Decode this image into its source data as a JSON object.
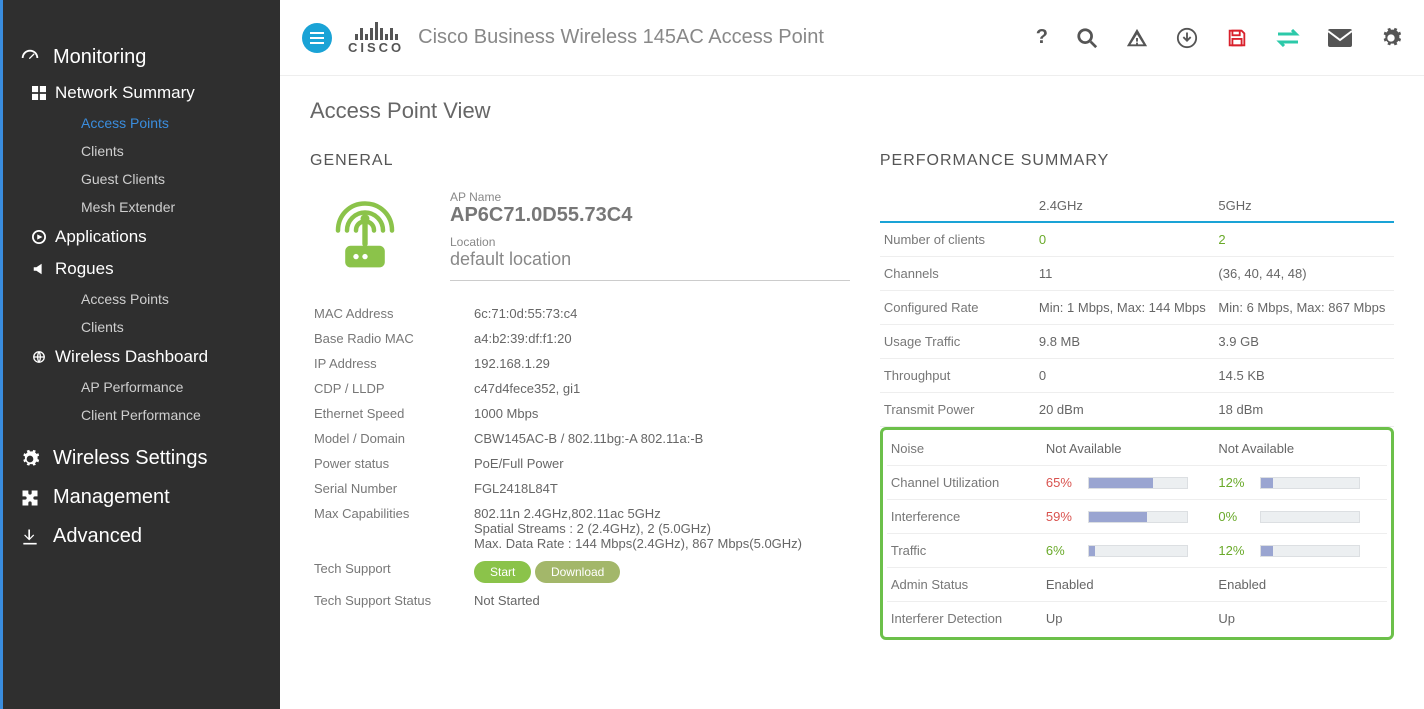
{
  "header": {
    "product_name": "Cisco Business Wireless 145AC Access Point",
    "logo_text": "CISCO"
  },
  "sidebar": {
    "monitoring": "Monitoring",
    "network_summary": "Network Summary",
    "ns_items": [
      "Access Points",
      "Clients",
      "Guest Clients",
      "Mesh Extender"
    ],
    "applications": "Applications",
    "rogues": "Rogues",
    "rogues_items": [
      "Access Points",
      "Clients"
    ],
    "wireless_dashboard": "Wireless Dashboard",
    "wd_items": [
      "AP Performance",
      "Client Performance"
    ],
    "wireless_settings": "Wireless Settings",
    "management": "Management",
    "advanced": "Advanced"
  },
  "page": {
    "title": "Access Point View",
    "general_head": "GENERAL",
    "perf_head": "PERFORMANCE SUMMARY"
  },
  "ap": {
    "name_label": "AP Name",
    "name": "AP6C71.0D55.73C4",
    "location_label": "Location",
    "location": "default location",
    "fields": [
      {
        "k": "MAC Address",
        "v": "6c:71:0d:55:73:c4"
      },
      {
        "k": "Base Radio MAC",
        "v": "a4:b2:39:df:f1:20"
      },
      {
        "k": "IP Address",
        "v": "192.168.1.29"
      },
      {
        "k": "CDP / LLDP",
        "v": "c47d4fece352, gi1"
      },
      {
        "k": "Ethernet Speed",
        "v": "1000 Mbps"
      },
      {
        "k": "Model / Domain",
        "v": "CBW145AC-B / 802.11bg:-A 802.11a:-B"
      },
      {
        "k": "Power status",
        "v": "PoE/Full Power"
      },
      {
        "k": "Serial Number",
        "v": "FGL2418L84T"
      },
      {
        "k": "Max Capabilities",
        "v": "802.11n 2.4GHz,802.11ac 5GHz\nSpatial Streams : 2 (2.4GHz), 2 (5.0GHz)\nMax. Data Rate : 144 Mbps(2.4GHz), 867 Mbps(5.0GHz)"
      }
    ],
    "tech_support_label": "Tech Support",
    "tech_start": "Start",
    "tech_download": "Download",
    "tech_status_label": "Tech Support Status",
    "tech_status": "Not Started"
  },
  "perf": {
    "col24": "2.4GHz",
    "col5": "5GHz",
    "rows_top": [
      {
        "k": "Number of clients",
        "a": "0",
        "b": "2",
        "a_cls": "green-t",
        "b_cls": "green-t"
      },
      {
        "k": "Channels",
        "a": "11",
        "b": "(36, 40, 44, 48)"
      },
      {
        "k": "Configured Rate",
        "a": "Min: 1 Mbps, Max: 144 Mbps",
        "b": "Min: 6 Mbps, Max: 867 Mbps"
      },
      {
        "k": "Usage Traffic",
        "a": "9.8 MB",
        "b": "3.9 GB"
      },
      {
        "k": "Throughput",
        "a": "0",
        "b": "14.5 KB"
      },
      {
        "k": "Transmit Power",
        "a": "20 dBm",
        "b": "18 dBm"
      }
    ],
    "noise": {
      "k": "Noise",
      "a": "Not Available",
      "b": "Not Available"
    },
    "chan_util": {
      "k": "Channel Utilization",
      "a_pct": 65,
      "b_pct": 12,
      "a_cls": "red-t",
      "b_cls": "green-t"
    },
    "interference": {
      "k": "Interference",
      "a_pct": 59,
      "b_pct": 0,
      "a_cls": "red-t",
      "b_cls": "green-t"
    },
    "traffic": {
      "k": "Traffic",
      "a_pct": 6,
      "b_pct": 12,
      "a_cls": "green-t",
      "b_cls": "green-t"
    },
    "admin": {
      "k": "Admin Status",
      "a": "Enabled",
      "b": "Enabled"
    },
    "interferer": {
      "k": "Interferer Detection",
      "a": "Up",
      "b": "Up"
    }
  }
}
